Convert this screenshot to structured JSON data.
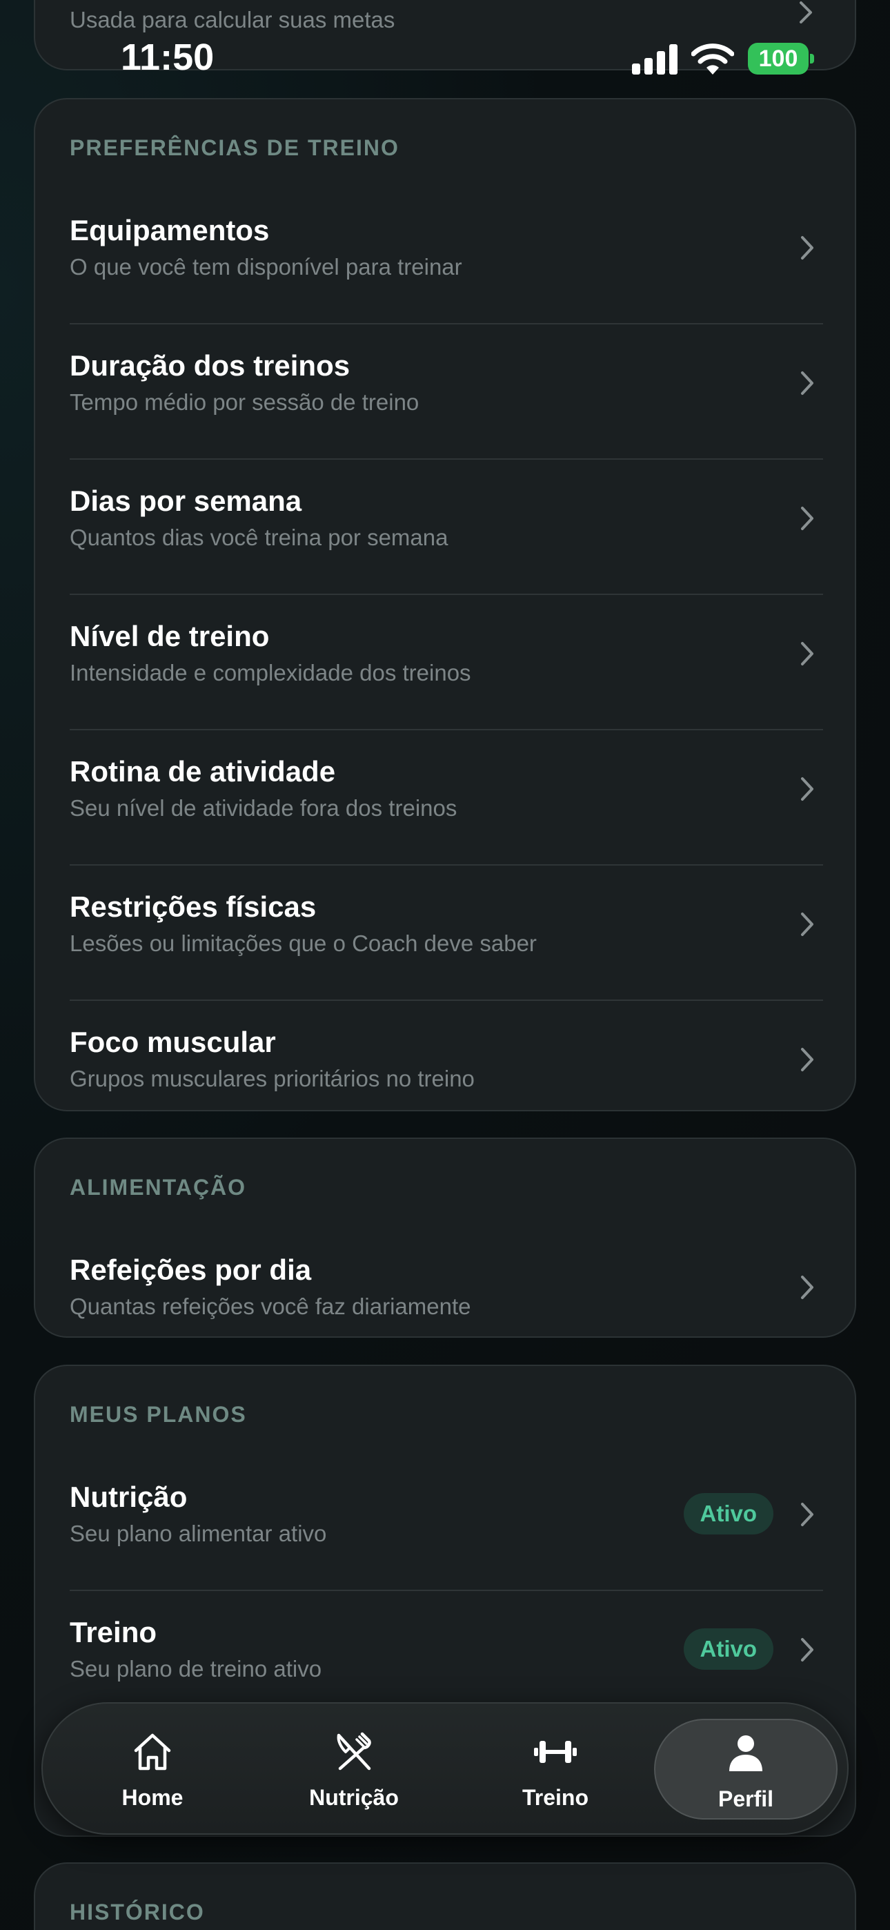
{
  "status_bar": {
    "time": "11:50",
    "battery": "100"
  },
  "top_card": {
    "subtitle": "Usada para calcular suas metas"
  },
  "training_prefs": {
    "section_title": "PREFERÊNCIAS DE TREINO",
    "items": [
      {
        "title": "Equipamentos",
        "subtitle": "O que você tem disponível para treinar"
      },
      {
        "title": "Duração dos treinos",
        "subtitle": "Tempo médio por sessão de treino"
      },
      {
        "title": "Dias por semana",
        "subtitle": "Quantos dias você treina por semana"
      },
      {
        "title": "Nível de treino",
        "subtitle": "Intensidade e complexidade dos treinos"
      },
      {
        "title": "Rotina de atividade",
        "subtitle": "Seu nível de atividade fora dos treinos"
      },
      {
        "title": "Restrições físicas",
        "subtitle": "Lesões ou limitações que o Coach deve saber"
      },
      {
        "title": "Foco muscular",
        "subtitle": "Grupos musculares prioritários no treino"
      }
    ]
  },
  "nutrition_prefs": {
    "section_title": "ALIMENTAÇÃO",
    "items": [
      {
        "title": "Refeições por dia",
        "subtitle": "Quantas refeições você faz diariamente"
      }
    ]
  },
  "plans": {
    "section_title": "MEUS PLANOS",
    "items": [
      {
        "title": "Nutrição",
        "subtitle": "Seu plano alimentar ativo",
        "badge": "Ativo"
      },
      {
        "title": "Treino",
        "subtitle": "Seu plano de treino ativo",
        "badge": "Ativo"
      }
    ]
  },
  "history": {
    "section_title": "HISTÓRICO"
  },
  "tabbar": {
    "tabs": [
      {
        "label": "Home",
        "icon": "home-icon"
      },
      {
        "label": "Nutrição",
        "icon": "fork-knife-icon"
      },
      {
        "label": "Treino",
        "icon": "dumbbell-icon"
      },
      {
        "label": "Perfil",
        "icon": "person-icon"
      }
    ],
    "active": "Perfil"
  },
  "colors": {
    "accent_green": "#4fc99c",
    "battery_green": "#33c159",
    "card_bg": "#1a1f21",
    "section_title": "#6f8a84"
  }
}
